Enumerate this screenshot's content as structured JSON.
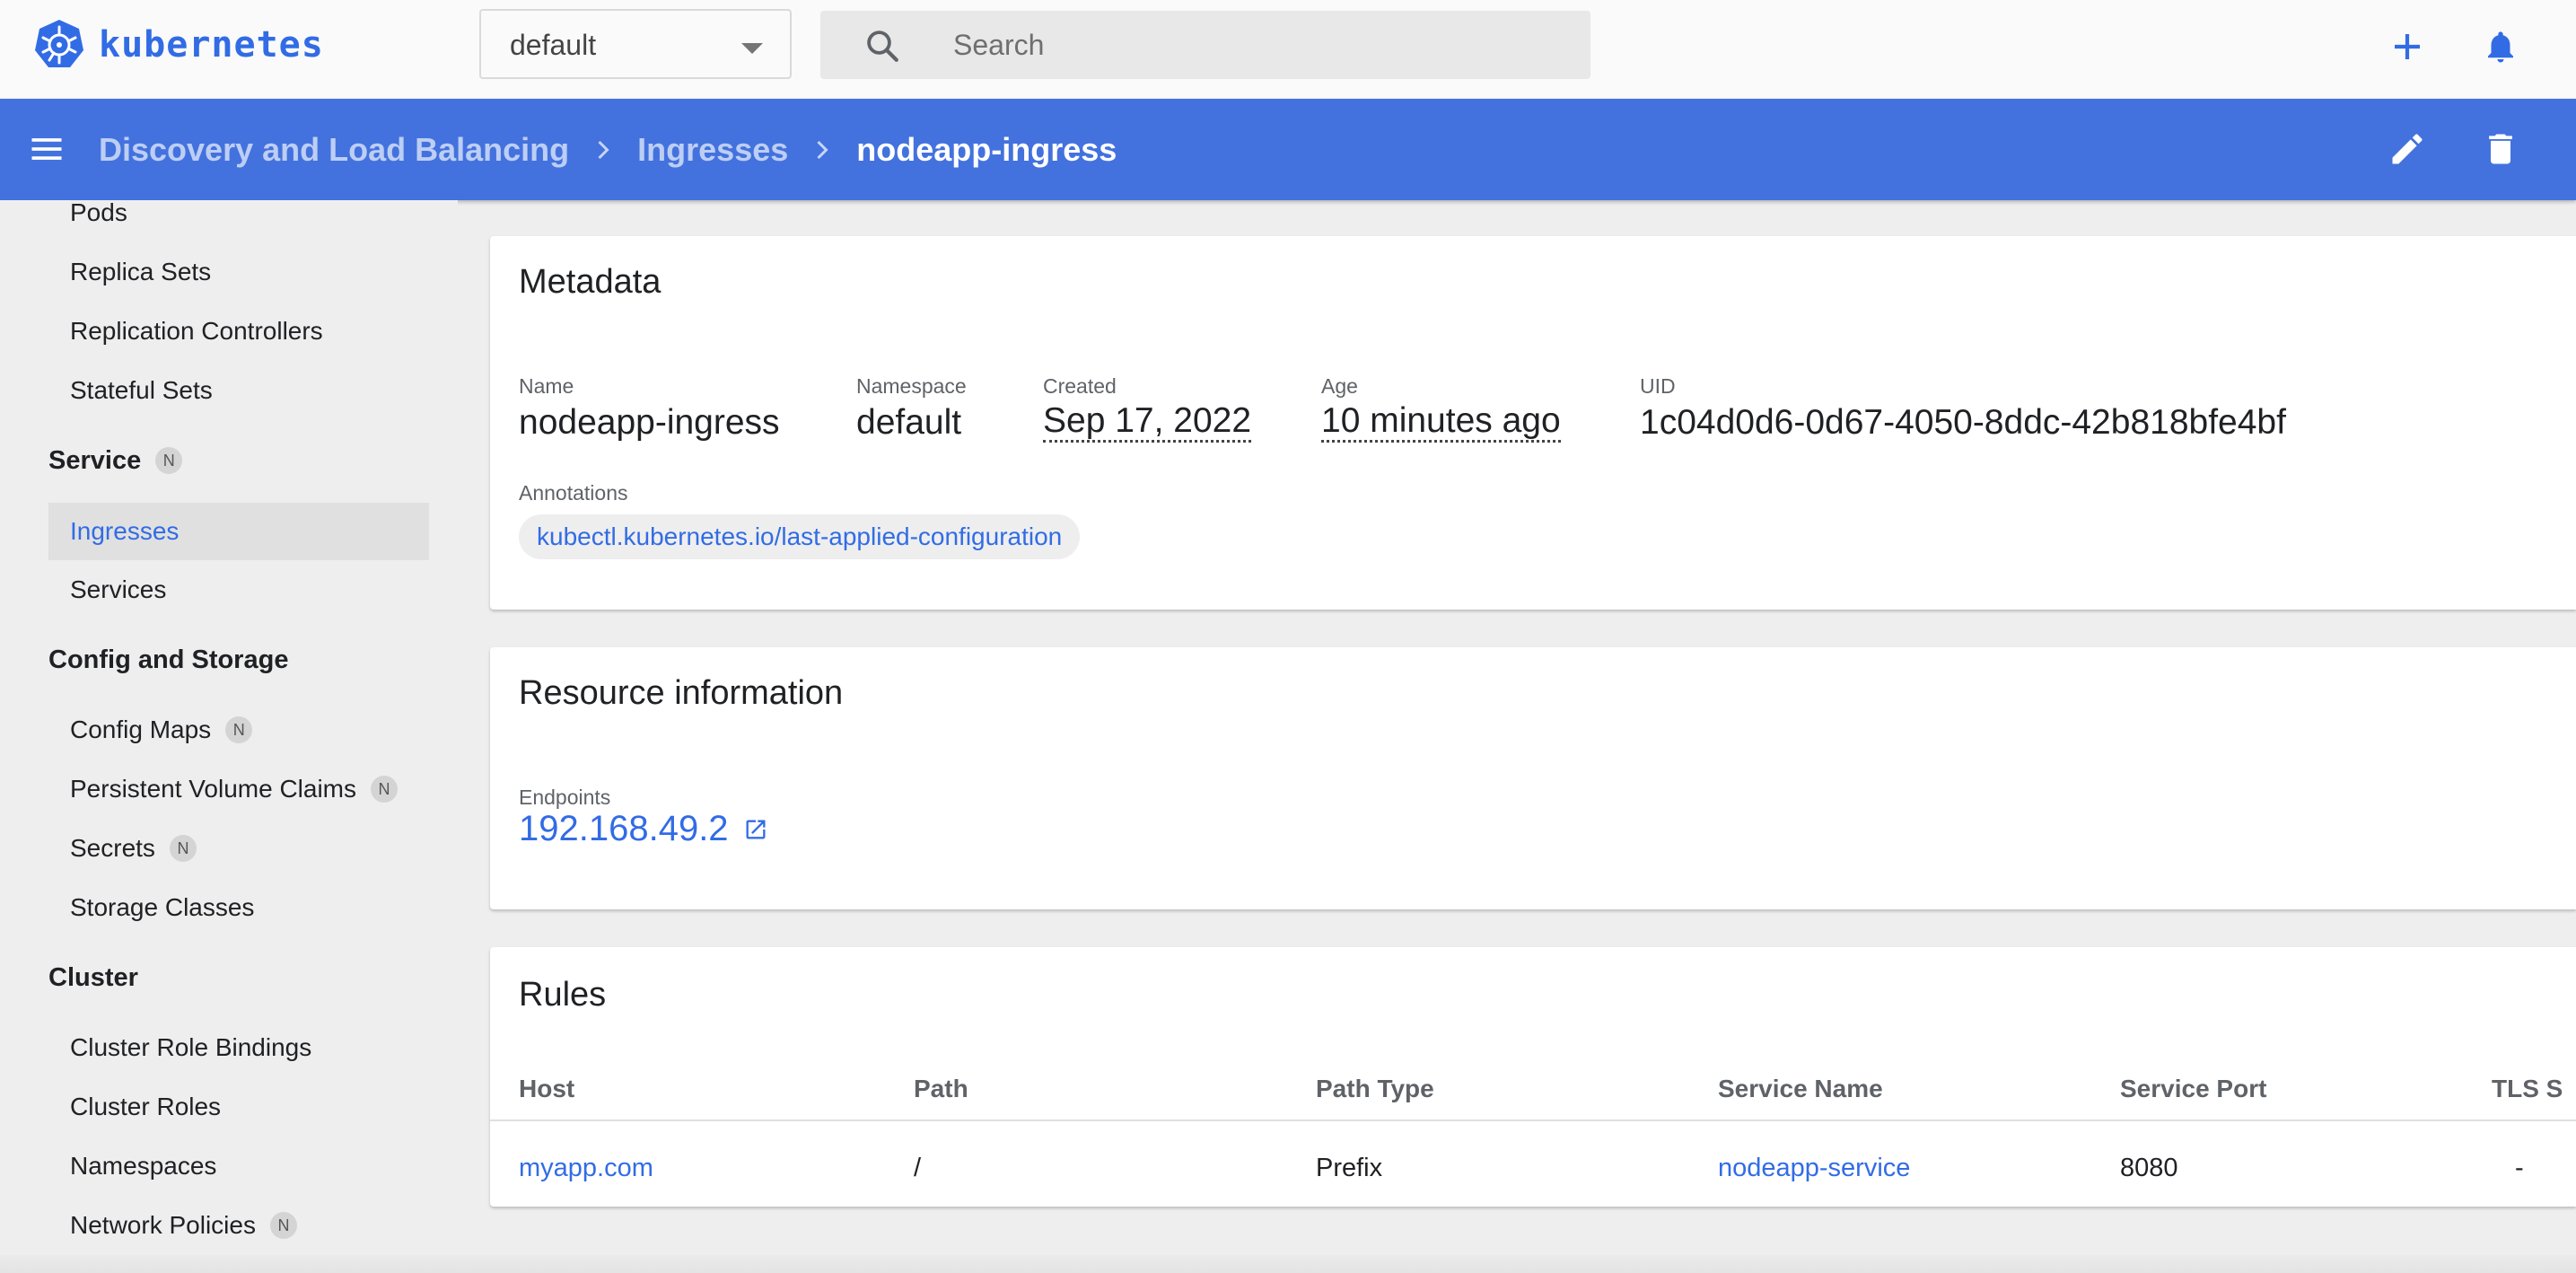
{
  "app": {
    "logo_text": "kubernetes",
    "brand_color": "#326ce5",
    "header_color": "#4372de"
  },
  "toolbar": {
    "namespace_selected": "default",
    "search_placeholder": "Search",
    "icons": {
      "add": "plus-icon",
      "notifications": "bell-icon"
    }
  },
  "header": {
    "breadcrumbs": [
      "Discovery and Load Balancing",
      "Ingresses",
      "nodeapp-ingress"
    ],
    "icons": {
      "menu": "menu-icon",
      "edit": "pencil-icon",
      "delete": "trash-icon"
    }
  },
  "sidebar": {
    "workloads_items": [
      "Pods",
      "Replica Sets",
      "Replication Controllers",
      "Stateful Sets"
    ],
    "service_section": {
      "label": "Service",
      "badge": "N"
    },
    "service_items": [
      {
        "label": "Ingresses",
        "active": true
      },
      {
        "label": "Services"
      }
    ],
    "config_section": {
      "label": "Config and Storage"
    },
    "config_items": [
      {
        "label": "Config Maps",
        "badge": "N"
      },
      {
        "label": "Persistent Volume Claims",
        "badge": "N"
      },
      {
        "label": "Secrets",
        "badge": "N"
      },
      {
        "label": "Storage Classes"
      }
    ],
    "cluster_section": {
      "label": "Cluster"
    },
    "cluster_items": [
      {
        "label": "Cluster Role Bindings"
      },
      {
        "label": "Cluster Roles"
      },
      {
        "label": "Namespaces"
      },
      {
        "label": "Network Policies",
        "badge": "N"
      }
    ]
  },
  "metadata": {
    "title": "Metadata",
    "fields": {
      "name": {
        "label": "Name",
        "value": "nodeapp-ingress"
      },
      "namespace": {
        "label": "Namespace",
        "value": "default"
      },
      "created": {
        "label": "Created",
        "value": "Sep 17, 2022"
      },
      "age": {
        "label": "Age",
        "value": "10 minutes ago"
      },
      "uid": {
        "label": "UID",
        "value": "1c04d0d6-0d67-4050-8ddc-42b818bfe4bf"
      }
    },
    "annotations_label": "Annotations",
    "annotations": [
      "kubectl.kubernetes.io/last-applied-configuration"
    ]
  },
  "resource_info": {
    "title": "Resource information",
    "endpoints_label": "Endpoints",
    "endpoint": "192.168.49.2"
  },
  "rules": {
    "title": "Rules",
    "columns": [
      "Host",
      "Path",
      "Path Type",
      "Service Name",
      "Service Port",
      "TLS S"
    ],
    "rows": [
      {
        "host": "myapp.com",
        "path": "/",
        "path_type": "Prefix",
        "service_name": "nodeapp-service",
        "service_port": "8080",
        "tls": "-"
      }
    ]
  }
}
